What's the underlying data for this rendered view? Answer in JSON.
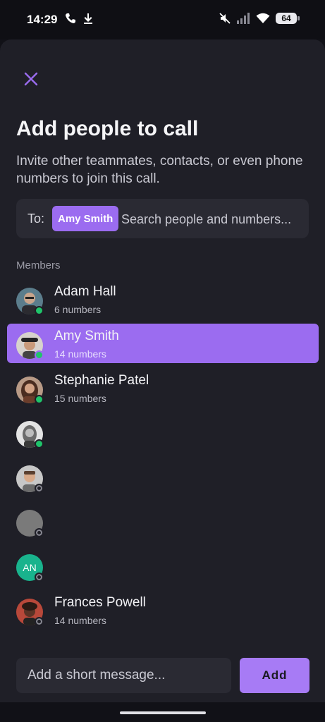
{
  "status_bar": {
    "time": "14:29",
    "battery": "64",
    "icons_left": [
      "phone-icon",
      "download-icon"
    ],
    "icons_right": [
      "mute-icon",
      "signal-icon",
      "wifi-icon",
      "battery-icon"
    ]
  },
  "sheet": {
    "close_icon": "close-icon",
    "title": "Add people to call",
    "subtitle": "Invite other teammates, contacts, or even phone numbers to join this call.",
    "to_label": "To:",
    "selected_chip": "Amy Smith",
    "search_placeholder": "Search people and numbers...",
    "members_label": "Members"
  },
  "members": [
    {
      "name": "Adam Hall",
      "count": "6 numbers",
      "status": "online"
    },
    {
      "name": "Amy Smith",
      "count": "14 numbers",
      "status": "online",
      "selected": true
    },
    {
      "name": "Stephanie Patel",
      "count": "15 numbers",
      "status": "online"
    },
    {
      "name": "",
      "count": "",
      "status": "online"
    },
    {
      "name": "",
      "count": "",
      "status": "offline"
    },
    {
      "name": "",
      "count": "",
      "status": "offline"
    },
    {
      "name": "",
      "count": "",
      "status": "offline",
      "initials": "AN"
    },
    {
      "name": "Frances Powell",
      "count": "14 numbers",
      "status": "offline"
    }
  ],
  "footer": {
    "message_placeholder": "Add a short message...",
    "add_label": "Add"
  },
  "colors": {
    "accent": "#9b6cf0",
    "online": "#1fc46a",
    "background": "#1f1f27"
  }
}
